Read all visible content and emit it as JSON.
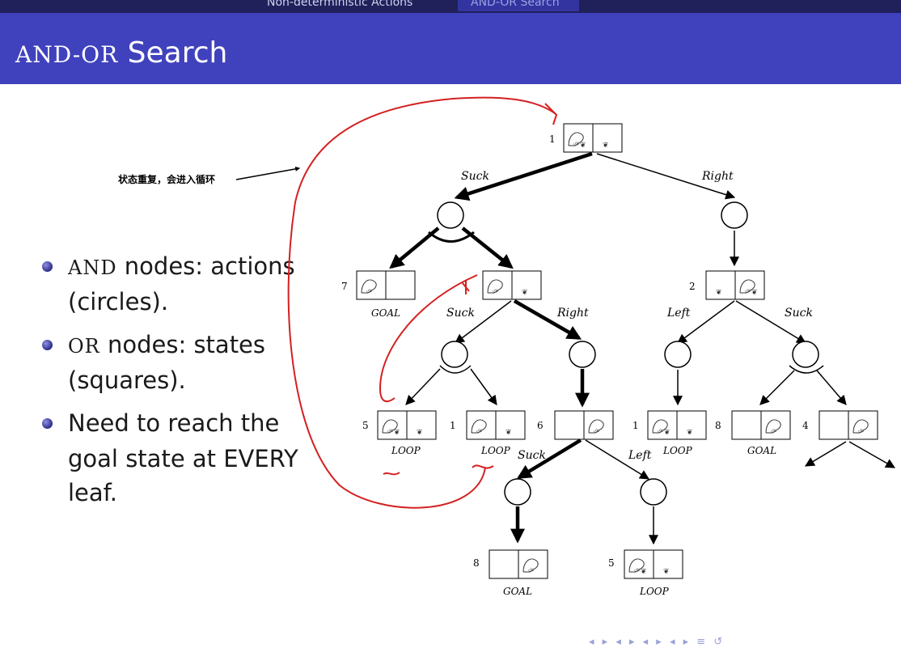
{
  "nav": {
    "tabs": [
      "Non-deterministic Actions",
      "AND-OR Search"
    ],
    "active_index": 1
  },
  "slide": {
    "title_smallcaps": "AND-OR",
    "title_rest": " Search",
    "bullets": [
      {
        "lead": "AND",
        "text": " nodes: actions (circles)."
      },
      {
        "lead": "OR",
        "text": " nodes: states (squares)."
      },
      {
        "lead": "",
        "text": "Need to reach the goal state at EVERY leaf."
      }
    ]
  },
  "annotation": {
    "text": "状态重复，会进入循环"
  },
  "tree": {
    "node_numbers": [
      "1",
      "7",
      "2",
      "5",
      "1",
      "6",
      "1",
      "8",
      "4",
      "8",
      "5"
    ],
    "action_labels": [
      "Suck",
      "Right",
      "Suck",
      "Right",
      "Left",
      "Suck",
      "Suck",
      "Left"
    ],
    "leaf_labels": [
      "GOAL",
      "LOOP",
      "LOOP",
      "LOOP",
      "GOAL",
      "GOAL",
      "LOOP"
    ]
  },
  "controls": {
    "glyphs": "◂ ▸ ◂ ▸ ◂ ▸ ◂ ▸ ≡ ↺"
  },
  "colors": {
    "header": "#4042bd",
    "nav": "#20205a",
    "annotation": "#d42020",
    "bullet": "#3a3aa0"
  }
}
